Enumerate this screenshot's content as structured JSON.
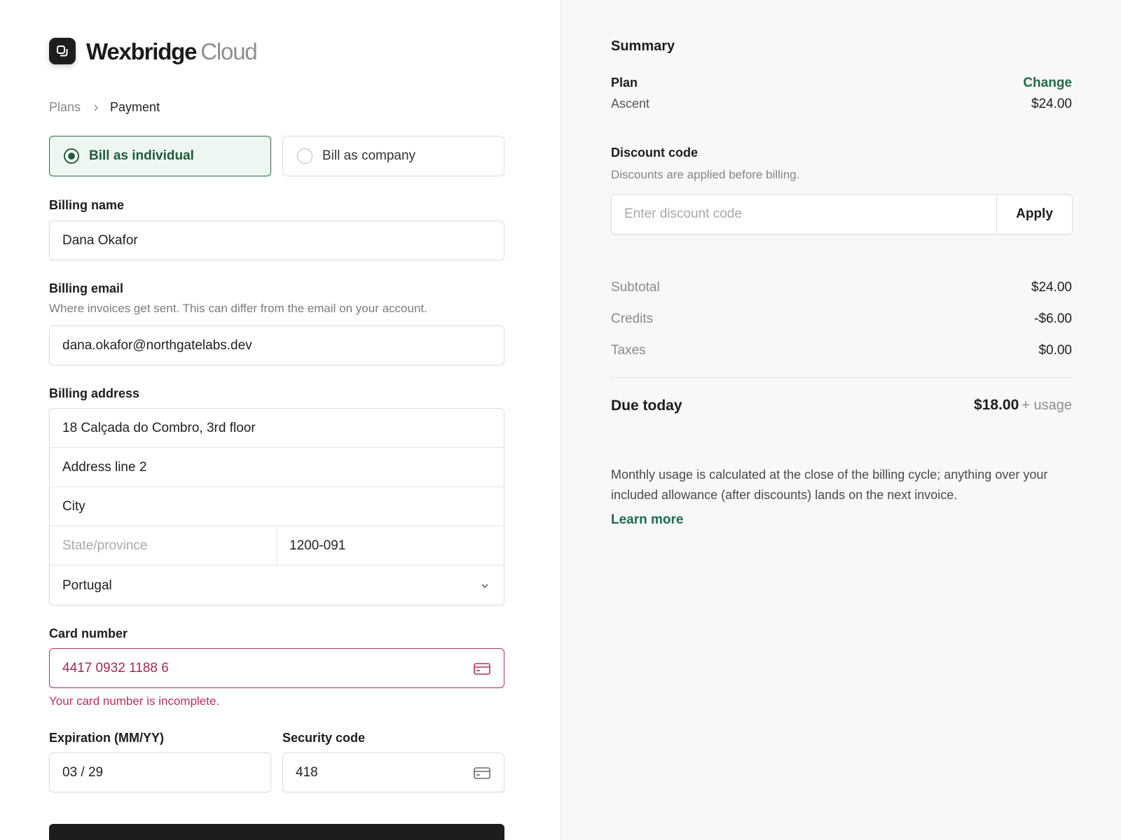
{
  "brand": {
    "name": "Wexbridge",
    "suffix": "Cloud",
    "logo_icon": "stacked-squares-icon"
  },
  "breadcrumb": {
    "previous": "Plans",
    "current": "Payment"
  },
  "billing_type": {
    "options": [
      {
        "label": "Bill as individual",
        "selected": true
      },
      {
        "label": "Bill as company",
        "selected": false
      }
    ]
  },
  "billing_name": {
    "label": "Billing name",
    "value": "Dana Okafor"
  },
  "billing_email": {
    "label": "Billing email",
    "help": "Where invoices get sent. This can differ from the email on your account.",
    "value": "dana.okafor@northgatelabs.dev"
  },
  "billing_address": {
    "label": "Billing address",
    "line1": "18 Calçada do Combro, 3rd floor",
    "line2_placeholder": "Address line 2",
    "city_placeholder": "City",
    "state_placeholder": "State/province",
    "postal_code": "1200-091",
    "country": "Portugal"
  },
  "card": {
    "label": "Card number",
    "value": "4417 0932 1188 6",
    "error": "Your card number is incomplete.",
    "expiration_label": "Expiration (MM/YY)",
    "expiration_value": "03 / 29",
    "security_label": "Security code",
    "security_value": "418"
  },
  "summary": {
    "title": "Summary",
    "plan_label": "Plan",
    "plan_name": "Ascent",
    "change_label": "Change",
    "plan_price": "$24.00",
    "discount_label": "Discount code",
    "discount_help": "Discounts are applied before billing.",
    "discount_placeholder": "Enter discount code",
    "apply_label": "Apply",
    "lines": [
      {
        "label": "Subtotal",
        "value": "$24.00"
      },
      {
        "label": "Credits",
        "value": "-$6.00"
      },
      {
        "label": "Taxes",
        "value": "$0.00"
      }
    ],
    "due_label": "Due today",
    "due_value": "$18.00",
    "due_suffix": "+ usage",
    "note": "Monthly usage is calculated at the close of the billing cycle; anything over your included allowance (after discounts) lands on the next invoice.",
    "learn_more": "Learn more"
  },
  "colors": {
    "accent_green": "#1f6b47",
    "selected_bg": "#eef6f1",
    "error_red": "#b3325a",
    "dark_button": "#1d1d1d",
    "summary_bg": "#f8f8f8"
  }
}
